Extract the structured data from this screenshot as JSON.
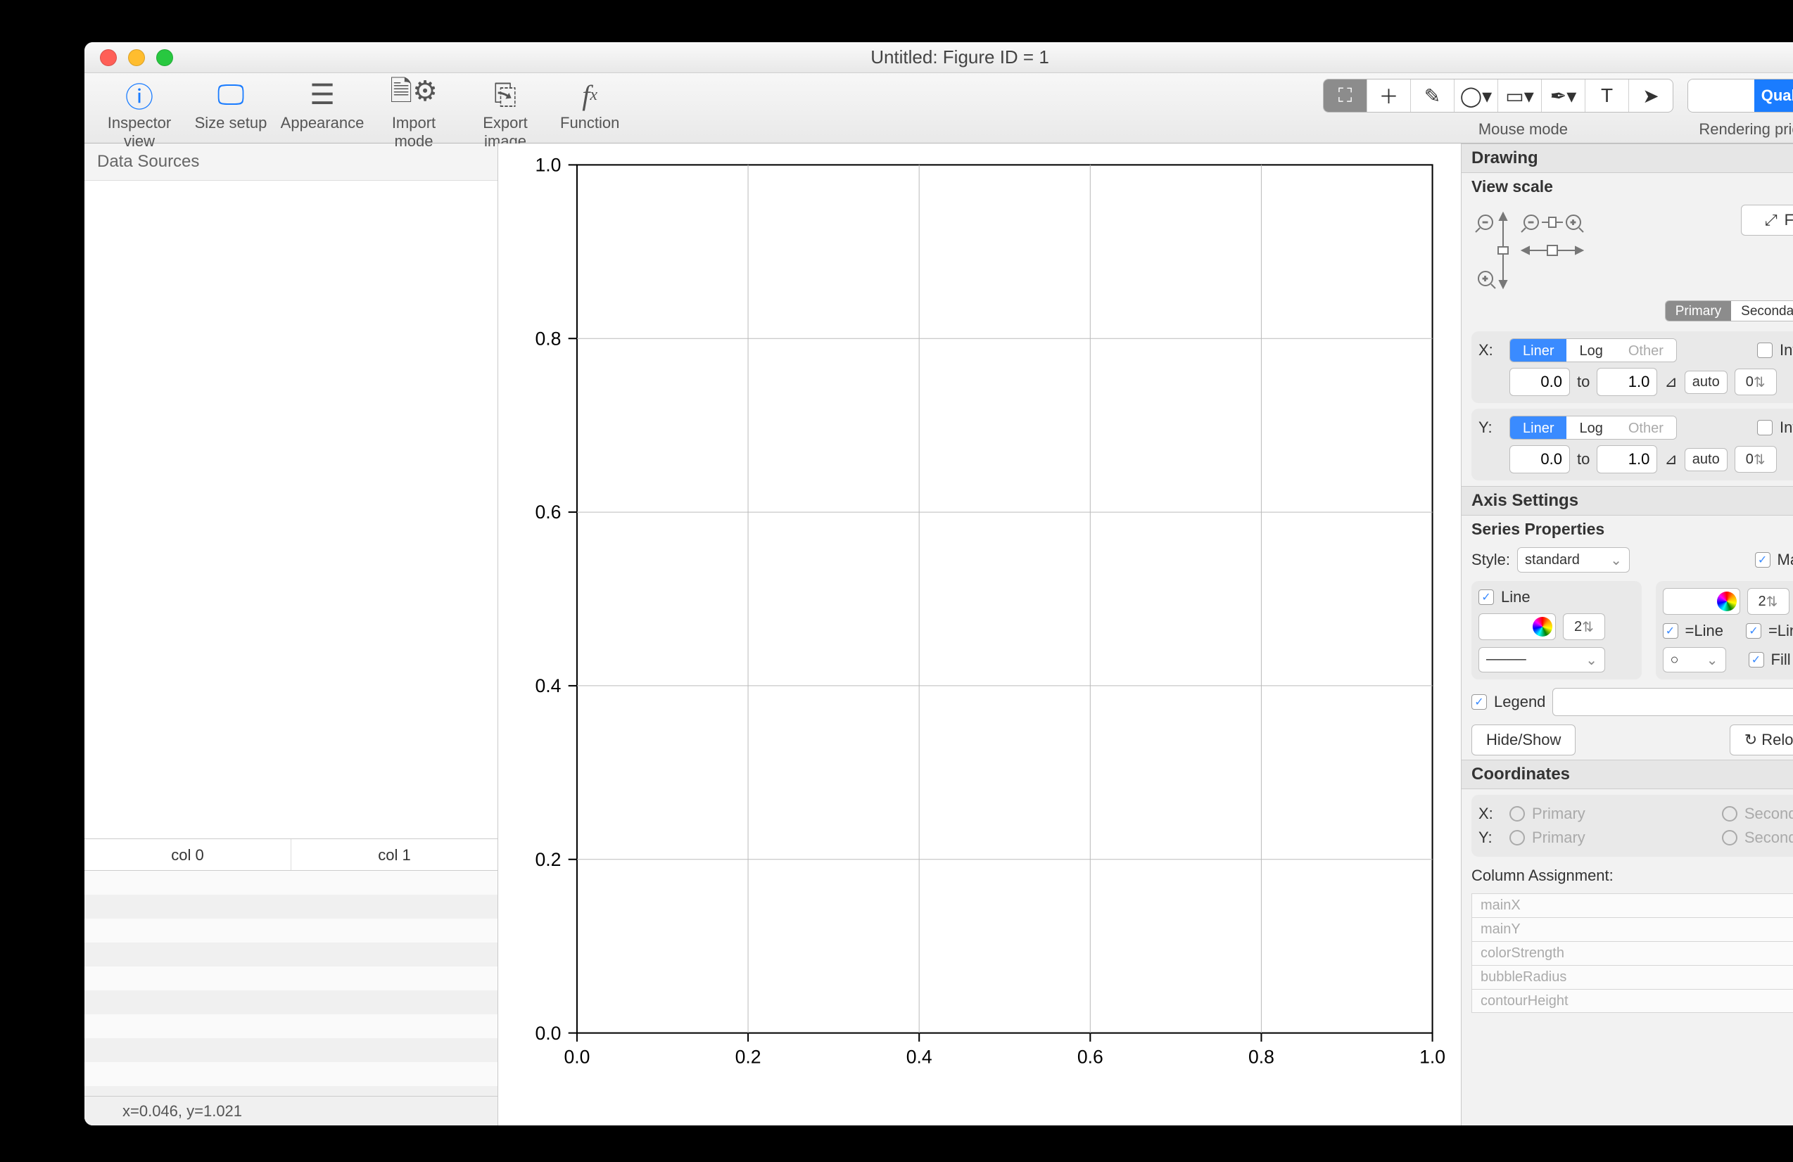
{
  "window": {
    "title": "Untitled: Figure ID = 1"
  },
  "toolbar": {
    "items": [
      {
        "label": "Inspector view",
        "icon": "ℹ️"
      },
      {
        "label": "Size setup",
        "icon": "🖥"
      },
      {
        "label": "Appearance",
        "icon": "🎛"
      },
      {
        "label": "Import mode",
        "icon": "📄"
      },
      {
        "label": "Export image",
        "icon": "📤"
      },
      {
        "label": "Function",
        "icon": "𝑓𝑥"
      }
    ],
    "mouse_mode_label": "Mouse mode",
    "mouse_modes": [
      "⛶",
      "＋",
      "✎",
      "◯▾",
      "▭▾",
      "✒▾",
      "T",
      "➤"
    ],
    "mouse_active_index": 0,
    "rendering_label": "Rendering priority",
    "rendering_options": [
      "",
      "Quality"
    ]
  },
  "left": {
    "data_sources_label": "Data Sources",
    "columns": [
      "col 0",
      "col 1"
    ]
  },
  "statusbar": {
    "coords": "x=0.046, y=1.021"
  },
  "chart_data": {
    "type": "scatter",
    "title": "",
    "series": [],
    "xlabel": "",
    "ylabel": "",
    "xlim": [
      0.0,
      1.0
    ],
    "ylim": [
      0.0,
      1.0
    ],
    "xticks": [
      0.0,
      0.2,
      0.4,
      0.6,
      0.8,
      1.0
    ],
    "yticks": [
      0.0,
      0.2,
      0.4,
      0.6,
      0.8,
      1.0
    ],
    "grid": true
  },
  "inspector": {
    "drawing_title": "Drawing",
    "view_scale_title": "View scale",
    "fit_label": "Fit",
    "axis_tabs": [
      "Primary",
      "Secondary"
    ],
    "axis_tab_active": 0,
    "x": {
      "label": "X:",
      "scale_options": [
        "Liner",
        "Log",
        "Other"
      ],
      "scale_active": 0,
      "invert_label": "Invert",
      "from": "0.0",
      "to_label": "to",
      "to": "1.0",
      "auto_label": "auto",
      "auto_val": "0"
    },
    "y": {
      "label": "Y:",
      "scale_options": [
        "Liner",
        "Log",
        "Other"
      ],
      "scale_active": 0,
      "invert_label": "Invert",
      "from": "0.0",
      "to_label": "to",
      "to": "1.0",
      "auto_label": "auto",
      "auto_val": "0"
    },
    "axis_settings_title": "Axis Settings",
    "series_props_title": "Series Properties",
    "style_label": "Style:",
    "style_value": "standard",
    "marker_label": "Marker",
    "line_label": "Line",
    "line_width": "2",
    "marker_size": "2",
    "eqline1": "=Line",
    "eqline2": "=Line",
    "fill_label": "Fill",
    "legend_label": "Legend",
    "hide_show_label": "Hide/Show",
    "reload_label": "Reload",
    "coordinates_title": "Coordinates",
    "coord_x_label": "X:",
    "coord_y_label": "Y:",
    "coord_primary": "Primary",
    "coord_secondary": "Secondary",
    "column_assignment_title": "Column Assignment:",
    "assignments": [
      "mainX",
      "mainY",
      "colorStrength",
      "bubbleRadius",
      "contourHeight"
    ]
  }
}
